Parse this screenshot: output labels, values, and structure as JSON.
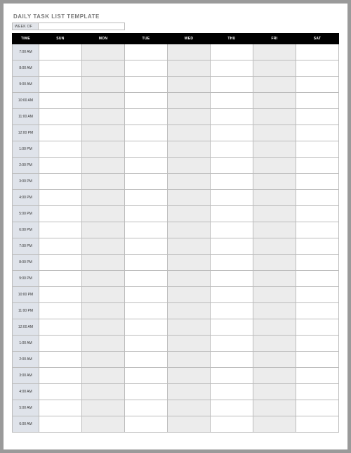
{
  "title": "DAILY TASK LIST TEMPLATE",
  "week_of_label": "WEEK OF",
  "week_of_value": "",
  "headers": {
    "time": "TIME",
    "sun": "SUN",
    "mon": "MON",
    "tue": "TUE",
    "wed": "WED",
    "thu": "THU",
    "fri": "FRI",
    "sat": "SAT"
  },
  "rows": [
    {
      "time": "7:00 AM"
    },
    {
      "time": "8:00 AM"
    },
    {
      "time": "9:00 AM"
    },
    {
      "time": "10:00 AM"
    },
    {
      "time": "11:00 AM"
    },
    {
      "time": "12:00 PM"
    },
    {
      "time": "1:00 PM"
    },
    {
      "time": "2:00 PM"
    },
    {
      "time": "3:00 PM"
    },
    {
      "time": "4:00 PM"
    },
    {
      "time": "5:00 PM"
    },
    {
      "time": "6:00 PM"
    },
    {
      "time": "7:00 PM"
    },
    {
      "time": "8:00 PM"
    },
    {
      "time": "9:00 PM"
    },
    {
      "time": "10:00 PM"
    },
    {
      "time": "11:00 PM"
    },
    {
      "time": "12:00 AM"
    },
    {
      "time": "1:00 AM"
    },
    {
      "time": "2:00 AM"
    },
    {
      "time": "3:00 AM"
    },
    {
      "time": "4:00 AM"
    },
    {
      "time": "5:00 AM"
    },
    {
      "time": "6:00 AM"
    }
  ],
  "alt_columns": [
    "mon",
    "wed",
    "fri"
  ]
}
